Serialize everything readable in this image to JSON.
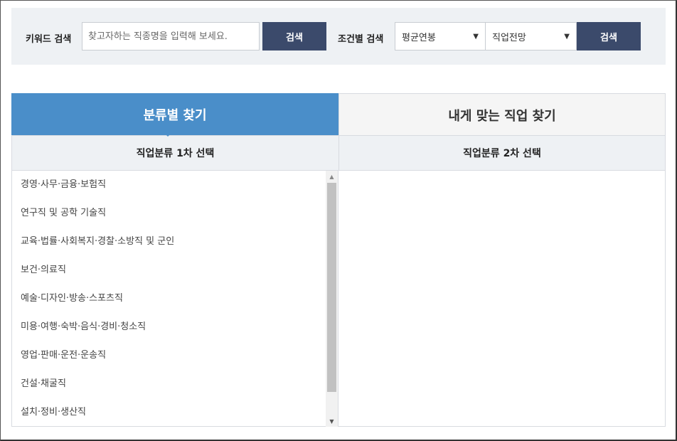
{
  "search": {
    "keyword_label": "키워드 검색",
    "keyword_placeholder": "찾고자하는 직종명을 입력해 보세요.",
    "keyword_button": "검색",
    "condition_label": "조건별 검색",
    "select_salary": "평균연봉",
    "select_outlook": "직업전망",
    "condition_button": "검색"
  },
  "tabs": [
    {
      "label": "분류별 찾기",
      "active": true
    },
    {
      "label": "내게 맞는 직업 찾기",
      "active": false
    }
  ],
  "columns": {
    "first": "직업분류 1차 선택",
    "second": "직업분류 2차 선택"
  },
  "categories": [
    "경영·사무·금융·보험직",
    "연구직 및 공학 기술직",
    "교육·법률·사회복지·경찰·소방직 및 군인",
    "보건·의료직",
    "예술·디자인·방송·스포츠직",
    "미용·여행·숙박·음식·경비·청소직",
    "영업·판매·운전·운송직",
    "건설·채굴직",
    "설치·정비·생산직"
  ],
  "colors": {
    "accent": "#4a8ec9",
    "button": "#3b4a6b",
    "panel_bg": "#eef1f4"
  }
}
